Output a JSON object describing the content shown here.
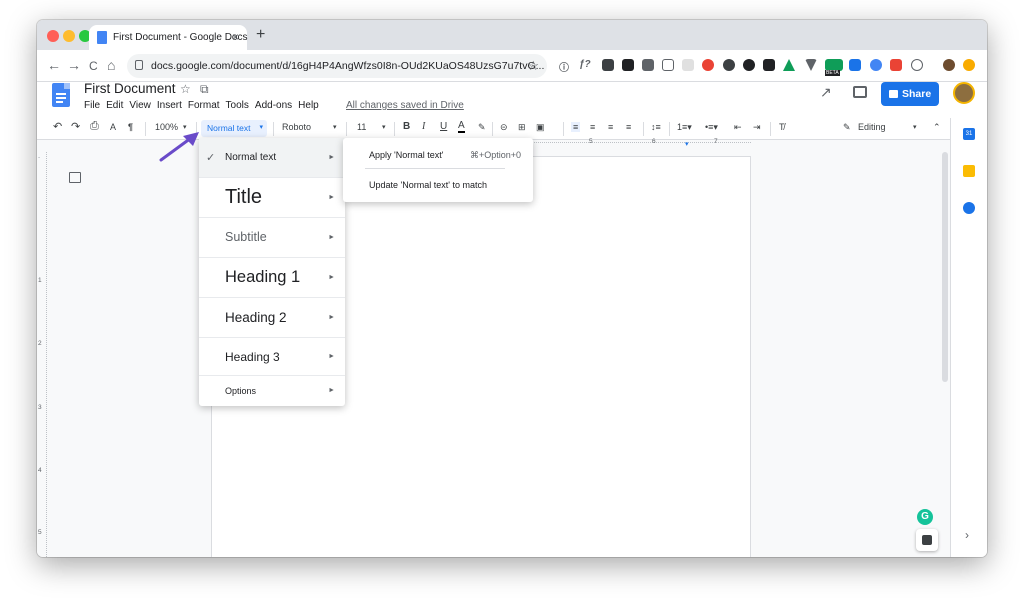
{
  "browser": {
    "tab_title": "First Document - Google Docs",
    "tab_close": "×",
    "new_tab": "+",
    "url": "docs.google.com/document/d/16gH4P4AngWfzs0I8n-OUd2KUaOS48UzsG7u7tvG...",
    "nav_back": "←",
    "nav_forward": "→",
    "nav_reload": "C",
    "nav_home": "⌂",
    "star": "☆",
    "ext_beta": "BETA"
  },
  "docs": {
    "title": "First Document",
    "star_icon": "☆",
    "folder_icon": "⧉",
    "menu": [
      "File",
      "Edit",
      "View",
      "Insert",
      "Format",
      "Tools",
      "Add-ons",
      "Help"
    ],
    "saved_status": "All changes saved in Drive",
    "share_label": "Share"
  },
  "toolbar": {
    "undo": "↶",
    "redo": "↷",
    "print": "⎙",
    "spell": "A",
    "paint": "¶",
    "zoom": "100%",
    "style": "Normal text",
    "font": "Roboto",
    "size": "11",
    "bold": "B",
    "italic": "I",
    "underline": "U",
    "color": "A",
    "mode": "Editing",
    "caret": "▾"
  },
  "ruler": {
    "h_marks": [
      "5",
      "6",
      "7"
    ],
    "v_marks": [
      "1",
      "2",
      "3",
      "4",
      "5"
    ]
  },
  "style_menu": {
    "items": [
      {
        "label": "Normal text",
        "checked": true
      },
      {
        "label": "Title"
      },
      {
        "label": "Subtitle"
      },
      {
        "label": "Heading 1"
      },
      {
        "label": "Heading 2"
      },
      {
        "label": "Heading 3"
      },
      {
        "label": "Options"
      }
    ],
    "check_glyph": "✓",
    "arrow_glyph": "►"
  },
  "submenu": {
    "apply": "Apply 'Normal text'",
    "apply_shortcut": "⌘+Option+0",
    "update": "Update 'Normal text' to match"
  },
  "side_panel": {
    "calendar": "31",
    "chevron": "›"
  },
  "grammarly": "G",
  "colors": {
    "accent": "#1a73e8",
    "arrow": "#6a4bc9"
  }
}
